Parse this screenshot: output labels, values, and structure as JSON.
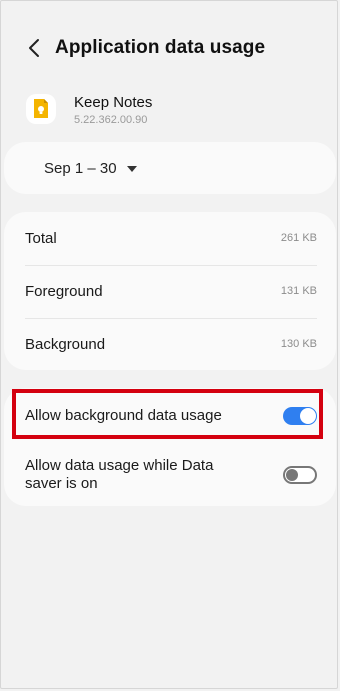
{
  "header": {
    "title": "Application data usage",
    "back_icon": "chevron-left-icon"
  },
  "app": {
    "name": "Keep Notes",
    "version": "5.22.362.00.90",
    "icon": "keep-notes-icon",
    "icon_color": "#f4b400"
  },
  "period": {
    "label": "Sep 1 – 30"
  },
  "usage": {
    "items": [
      {
        "label": "Total",
        "value": "261 KB"
      },
      {
        "label": "Foreground",
        "value": "131 KB"
      },
      {
        "label": "Background",
        "value": "130 KB"
      }
    ]
  },
  "settings": {
    "items": [
      {
        "label": "Allow background data usage",
        "state": "on"
      },
      {
        "label": "Allow data usage while Data saver is on",
        "state": "off"
      }
    ]
  },
  "colors": {
    "accent": "#2f7ff0",
    "highlight": "#d4000f"
  }
}
